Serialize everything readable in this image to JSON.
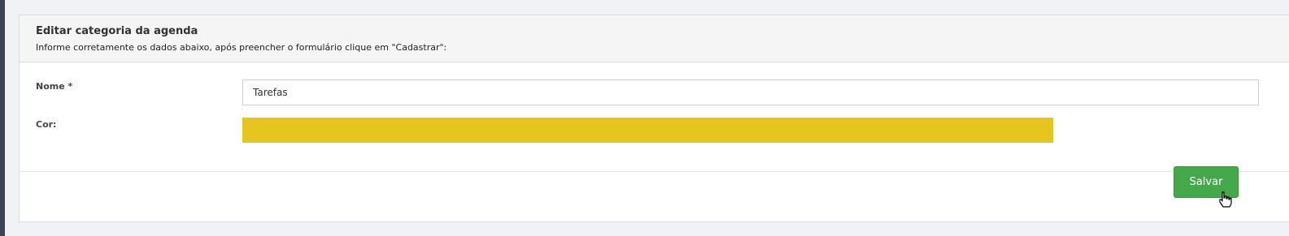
{
  "panel": {
    "title": "Editar categoria da agenda",
    "subtitle": "Informe corretamente os dados abaixo, após preencher o formulário clique em \"Cadastrar\":"
  },
  "form": {
    "name_label": "Nome *",
    "name_value": "Tarefas",
    "color_label": "Cor:",
    "color_value": "#e5c51e"
  },
  "footer": {
    "save_label": "Salvar"
  },
  "icons": {
    "cursor": "hand-pointer-icon"
  }
}
